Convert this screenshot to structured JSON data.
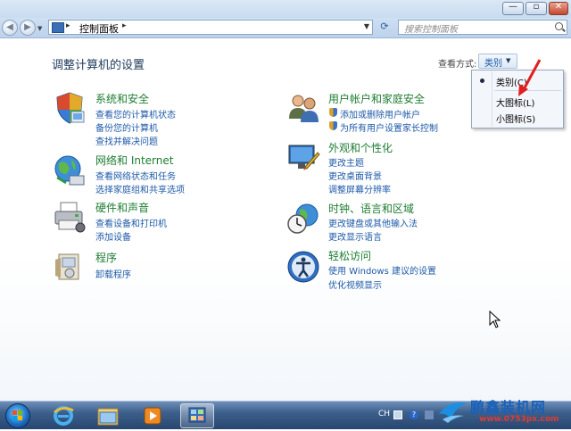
{
  "window": {
    "minimize_glyph": "—",
    "maximize_glyph": "▫",
    "close_glyph": "✕"
  },
  "address": {
    "breadcrumb": "控制面板",
    "separator": "▸",
    "search_placeholder": "搜索控制面板"
  },
  "header": {
    "title": "调整计算机的设置",
    "view_by_label": "查看方式:",
    "view_by_value": "类别"
  },
  "categories": [
    {
      "title": "系统和安全",
      "links": [
        "查看您的计算机状态",
        "备份您的计算机",
        "查找并解决问题"
      ],
      "icon": "shield-icon"
    },
    {
      "title": "网络和 Internet",
      "links": [
        "查看网络状态和任务",
        "选择家庭组和共享选项"
      ],
      "icon": "network-globe-icon"
    },
    {
      "title": "硬件和声音",
      "links": [
        "查看设备和打印机",
        "添加设备"
      ],
      "icon": "printer-icon"
    },
    {
      "title": "程序",
      "links": [
        "卸载程序"
      ],
      "icon": "programs-icon"
    },
    {
      "title": "用户帐户和家庭安全",
      "links": [
        "添加或删除用户帐户",
        "为所有用户设置家长控制"
      ],
      "icon": "users-icon"
    },
    {
      "title": "外观和个性化",
      "links": [
        "更改主题",
        "更改桌面背景",
        "调整屏幕分辨率"
      ],
      "icon": "appearance-icon"
    },
    {
      "title": "时钟、语言和区域",
      "links": [
        "更改键盘或其他输入法",
        "更改显示语言"
      ],
      "icon": "clock-globe-icon"
    },
    {
      "title": "轻松访问",
      "links": [
        "使用 Windows 建议的设置",
        "优化视频显示"
      ],
      "icon": "ease-of-access-icon"
    }
  ],
  "view_menu": {
    "items": [
      "类别(C)",
      "大图标(L)",
      "小图标(S)"
    ],
    "selected": "类别(C)"
  },
  "taskbar": {
    "tray_language": "CH"
  },
  "watermark": {
    "name": "鹏鑫装机网",
    "url": "www.0753px.com"
  },
  "colors": {
    "category_title": "#1e7d32",
    "link": "#1e5aa8",
    "arrow": "#e02020"
  }
}
